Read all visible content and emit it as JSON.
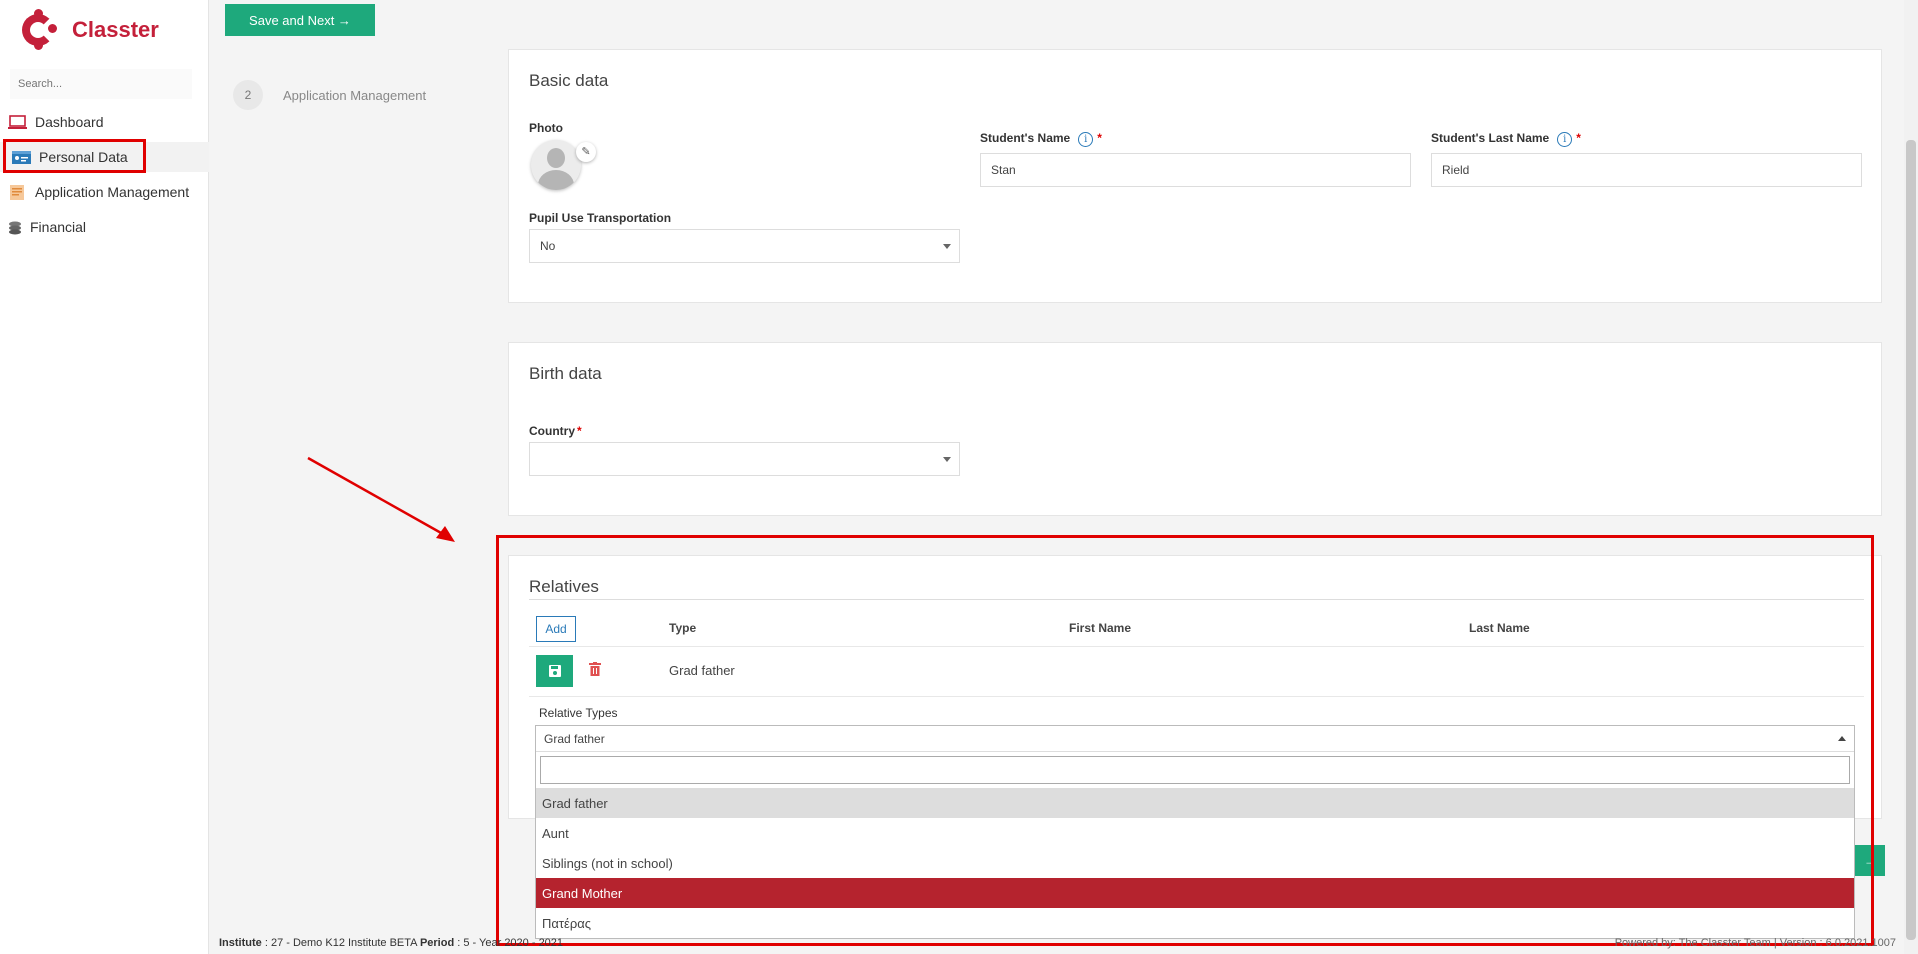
{
  "app": {
    "brand": "Classter"
  },
  "sidebar": {
    "search_placeholder": "Search...",
    "items": [
      {
        "label": "Dashboard",
        "icon": "laptop-icon"
      },
      {
        "label": "Personal Data",
        "icon": "id-card-icon"
      },
      {
        "label": "Application Management",
        "icon": "document-icon"
      },
      {
        "label": "Financial",
        "icon": "coins-icon"
      }
    ]
  },
  "toolbar": {
    "save_next": "Save and Next →"
  },
  "stepper": {
    "number": "2",
    "label": "Application Management"
  },
  "basic": {
    "title": "Basic data",
    "photo_label": "Photo",
    "name_label": "Student's Name",
    "name_value": "Stan",
    "lastname_label": "Student's Last Name",
    "lastname_value": "Rield",
    "transport_label": "Pupil Use Transportation",
    "transport_value": "No",
    "required_mark": "*",
    "info_glyph": "i"
  },
  "birth": {
    "title": "Birth data",
    "country_label": "Country",
    "country_value": ""
  },
  "relatives": {
    "title": "Relatives",
    "add_label": "Add",
    "columns": [
      "Type",
      "First Name",
      "Last Name"
    ],
    "row_type": "Grad father",
    "relative_types_label": "Relative Types",
    "selected": "Grad father",
    "options": [
      "Grad father",
      "Aunt",
      "Siblings (not in school)",
      "Grand Mother",
      "Πατέρας"
    ]
  },
  "footer": {
    "institute_key": "Institute",
    "institute_value": " : 27 - Demo K12 Institute BETA ",
    "period_key": "Period",
    "period_value": " : 5 - Year 2020 - 2021",
    "right_text": "Powered by: The Classter Team  | Version : 6.0.2021.1007"
  },
  "colors": {
    "brand": "#c4203a",
    "accent": "#1ea97c",
    "selected_option": "#b5232e",
    "annotation": "#e00000",
    "info": "#2a7ab8"
  }
}
